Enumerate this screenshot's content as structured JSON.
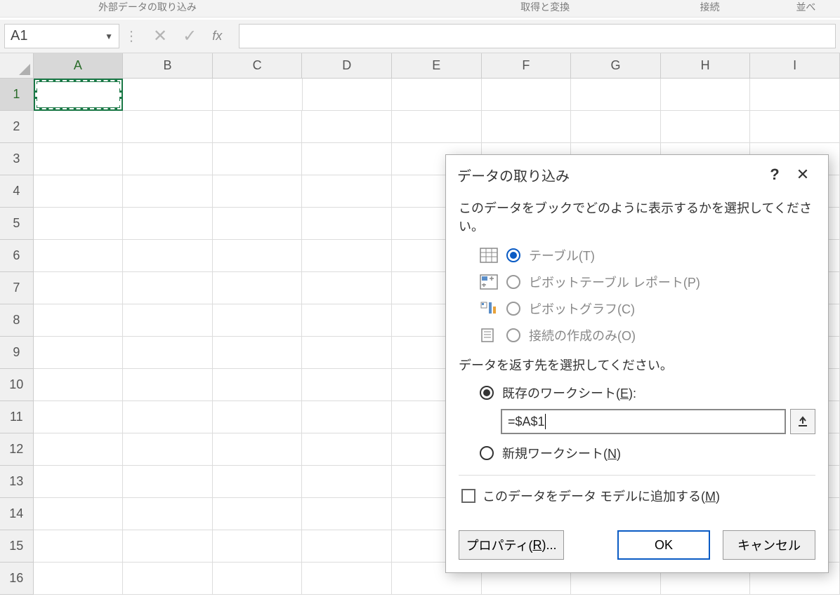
{
  "ribbon": {
    "group1": "外部データの取り込み",
    "group2": "取得と変換",
    "group3": "接続",
    "group4": "並べ"
  },
  "nameBox": {
    "value": "A1"
  },
  "fx": {
    "label": "fx",
    "formula": ""
  },
  "columns": [
    "A",
    "B",
    "C",
    "D",
    "E",
    "F",
    "G",
    "H",
    "I"
  ],
  "rowCount": 16,
  "activeCell": "A1",
  "dialog": {
    "title": "データの取り込み",
    "help": "?",
    "close": "✕",
    "prompt1": "このデータをブックでどのように表示するかを選択してください。",
    "options": [
      {
        "label": "テーブル(T)",
        "checked": true
      },
      {
        "label": "ピボットテーブル レポート(P)",
        "checked": false
      },
      {
        "label": "ピボットグラフ(C)",
        "checked": false
      },
      {
        "label": "接続の作成のみ(O)",
        "checked": false
      }
    ],
    "prompt2": "データを返す先を選択してください。",
    "destExisting": {
      "label": "既存のワークシート(E):",
      "checked": true
    },
    "rangeValue": "=$A$1",
    "destNew": {
      "label": "新規ワークシート(N)",
      "checked": false
    },
    "addToModel": "このデータをデータ モデルに追加する(M)",
    "btnProperties": "プロパティ(R)...",
    "btnOK": "OK",
    "btnCancel": "キャンセル"
  }
}
